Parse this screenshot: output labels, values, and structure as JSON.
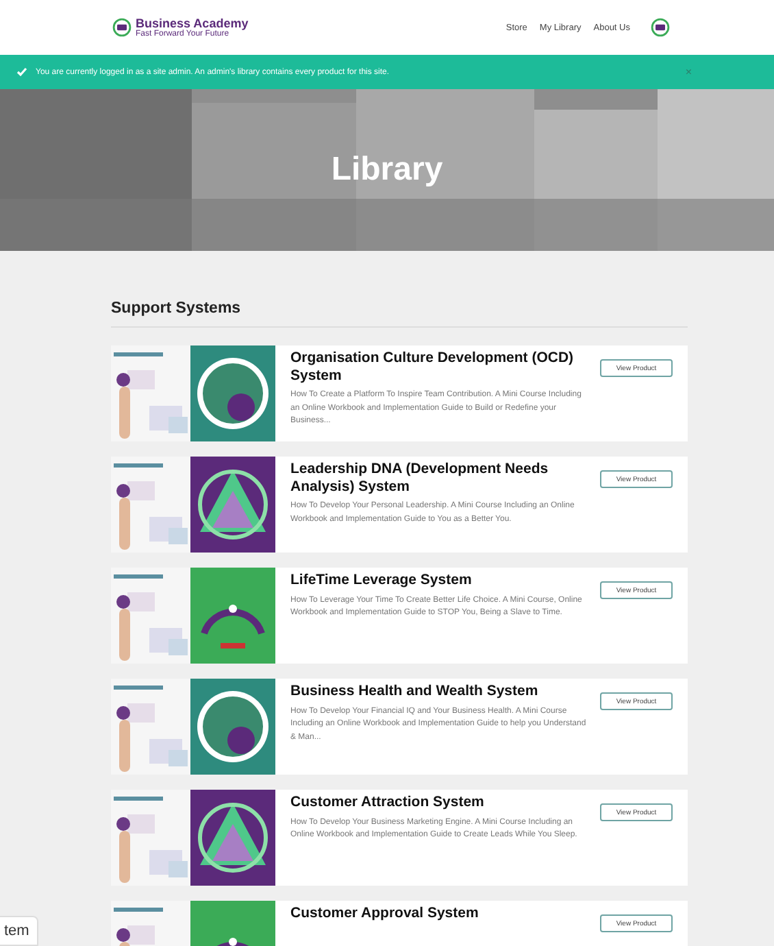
{
  "header": {
    "logo_title": "Business Academy",
    "logo_tagline": "Fast Forward Your Future",
    "nav": [
      "Store",
      "My Library",
      "About Us"
    ]
  },
  "notice": {
    "text": "You are currently logged in as a site admin. An admin's library contains every product for this site.",
    "close": "×"
  },
  "hero": {
    "title": "Library"
  },
  "section": {
    "title": "Support Systems"
  },
  "products": [
    {
      "title": "Organisation Culture Development (OCD) System",
      "description": "How To Create a Platform To Inspire Team Contribution. A Mini Course Including an Online Workbook and Implementation Guide to Build or Redefine your Business...",
      "button": "View Product"
    },
    {
      "title": "Leadership DNA (Development Needs Analysis) System",
      "description": "How To Develop Your Personal Leadership. A Mini Course Including an Online Workbook and Implementation Guide to You as a Better You.",
      "button": "View Product"
    },
    {
      "title": "LifeTime Leverage System",
      "description": "How To Leverage Your Time To Create Better Life Choice. A Mini Course, Online Workbook and Implementation Guide to STOP You, Being a Slave to Time.",
      "button": "View Product"
    },
    {
      "title": "Business Health and Wealth System",
      "description": "How To Develop Your Financial IQ and Your Business Health. A Mini Course Including an Online Workbook and Implementation Guide to help you Understand & Man...",
      "button": "View Product"
    },
    {
      "title": "Customer Attraction System",
      "description": "How To Develop Your Business Marketing Engine. A Mini Course Including an Online Workbook and Implementation Guide to Create Leads While You Sleep.",
      "button": "View Product"
    },
    {
      "title": "Customer Approval System",
      "button": "View Product"
    }
  ],
  "side_tab": {
    "text": "tem"
  }
}
